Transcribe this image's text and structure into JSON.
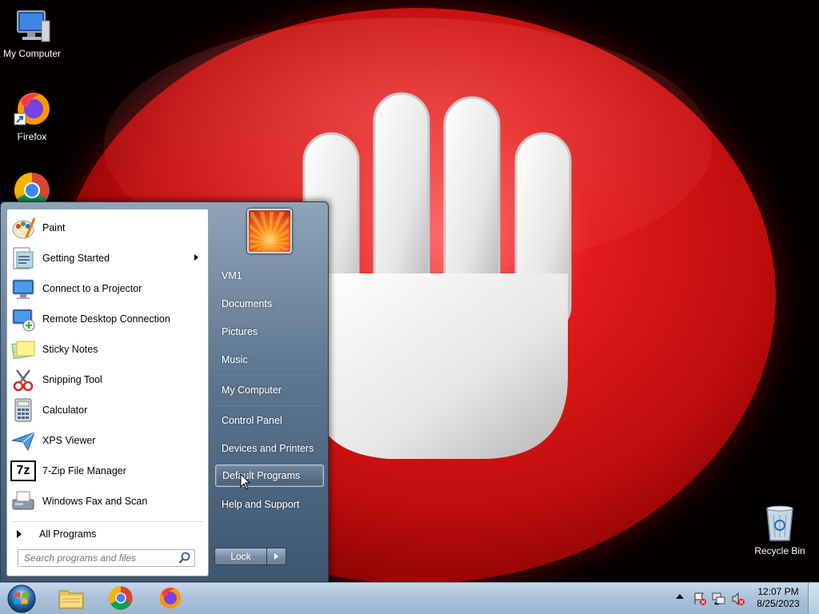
{
  "desktop": {
    "icons": [
      {
        "label": "My Computer"
      },
      {
        "label": "Firefox"
      },
      {
        "label": "Recycle Bin"
      }
    ]
  },
  "start_menu": {
    "programs": [
      {
        "label": "Paint",
        "icon": "paint-icon"
      },
      {
        "label": "Getting Started",
        "icon": "getting-started-icon",
        "has_submenu": true
      },
      {
        "label": "Connect to a Projector",
        "icon": "projector-icon"
      },
      {
        "label": "Remote Desktop Connection",
        "icon": "remote-desktop-icon"
      },
      {
        "label": "Sticky Notes",
        "icon": "sticky-notes-icon"
      },
      {
        "label": "Snipping Tool",
        "icon": "snipping-tool-icon"
      },
      {
        "label": "Calculator",
        "icon": "calculator-icon"
      },
      {
        "label": "XPS Viewer",
        "icon": "xps-viewer-icon"
      },
      {
        "label": "7-Zip File Manager",
        "icon": "7zip-icon",
        "icon_text": "7z"
      },
      {
        "label": "Windows Fax and Scan",
        "icon": "fax-scan-icon"
      }
    ],
    "all_programs": "All Programs",
    "search": {
      "placeholder": "Search programs and files"
    },
    "right_items": [
      {
        "label": "VM1"
      },
      {
        "label": "Documents"
      },
      {
        "label": "Pictures"
      },
      {
        "label": "Music"
      },
      {
        "label": "My Computer"
      },
      {
        "label": "Control Panel"
      },
      {
        "label": "Devices and Printers"
      },
      {
        "label": "Default Programs",
        "highlighted": true
      },
      {
        "label": "Help and Support"
      }
    ],
    "lock_label": "Lock"
  },
  "taskbar": {
    "pinned": [
      "file-explorer-icon",
      "chrome-icon",
      "firefox-icon"
    ],
    "clock": {
      "time": "12:07 PM",
      "date": "8/25/2023"
    }
  },
  "colors": {
    "wallpaper_red": "#e21b1b",
    "start_menu_blue": "#5e7690",
    "taskbar": "#a9c1d9"
  }
}
